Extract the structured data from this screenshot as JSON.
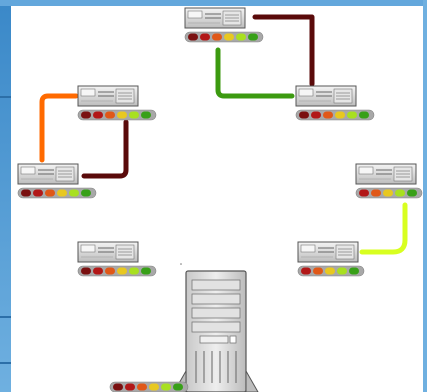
{
  "colors": {
    "frame": "#5aa2d8",
    "link_dark_red": "#5a0a0a",
    "link_green": "#3c9a10",
    "link_orange": "#ff6a00",
    "link_yellow": "#d8ff20",
    "server_body": "#d0d0d0",
    "led_palette": [
      "#7a1010",
      "#b21818",
      "#e05818",
      "#e8c820",
      "#a8e020",
      "#38a018"
    ]
  },
  "icons": {
    "server": "rack-server-icon",
    "tower": "tower-server-icon",
    "status_bar": "status-led-bar-icon"
  },
  "nodes": [
    {
      "id": "server-top",
      "leds": 6
    },
    {
      "id": "server-upper-right",
      "leds": 6
    },
    {
      "id": "server-upper-left",
      "leds": 6
    },
    {
      "id": "server-mid-left",
      "leds": 6
    },
    {
      "id": "server-right",
      "leds": 5
    },
    {
      "id": "server-lower-left",
      "leds": 6
    },
    {
      "id": "server-lower-right",
      "leds": 5
    },
    {
      "id": "tower-main",
      "leds": 6
    }
  ],
  "links": [
    {
      "from": "server-top",
      "to": "server-upper-right",
      "color": "link_dark_red"
    },
    {
      "from": "server-upper-right",
      "to": "server-top",
      "color": "link_green"
    },
    {
      "from": "server-upper-left",
      "to": "server-mid-left",
      "color": "link_orange"
    },
    {
      "from": "server-mid-left",
      "to": "server-upper-left",
      "color": "link_dark_red"
    },
    {
      "from": "server-right",
      "to": "server-lower-right",
      "color": "link_yellow"
    }
  ]
}
